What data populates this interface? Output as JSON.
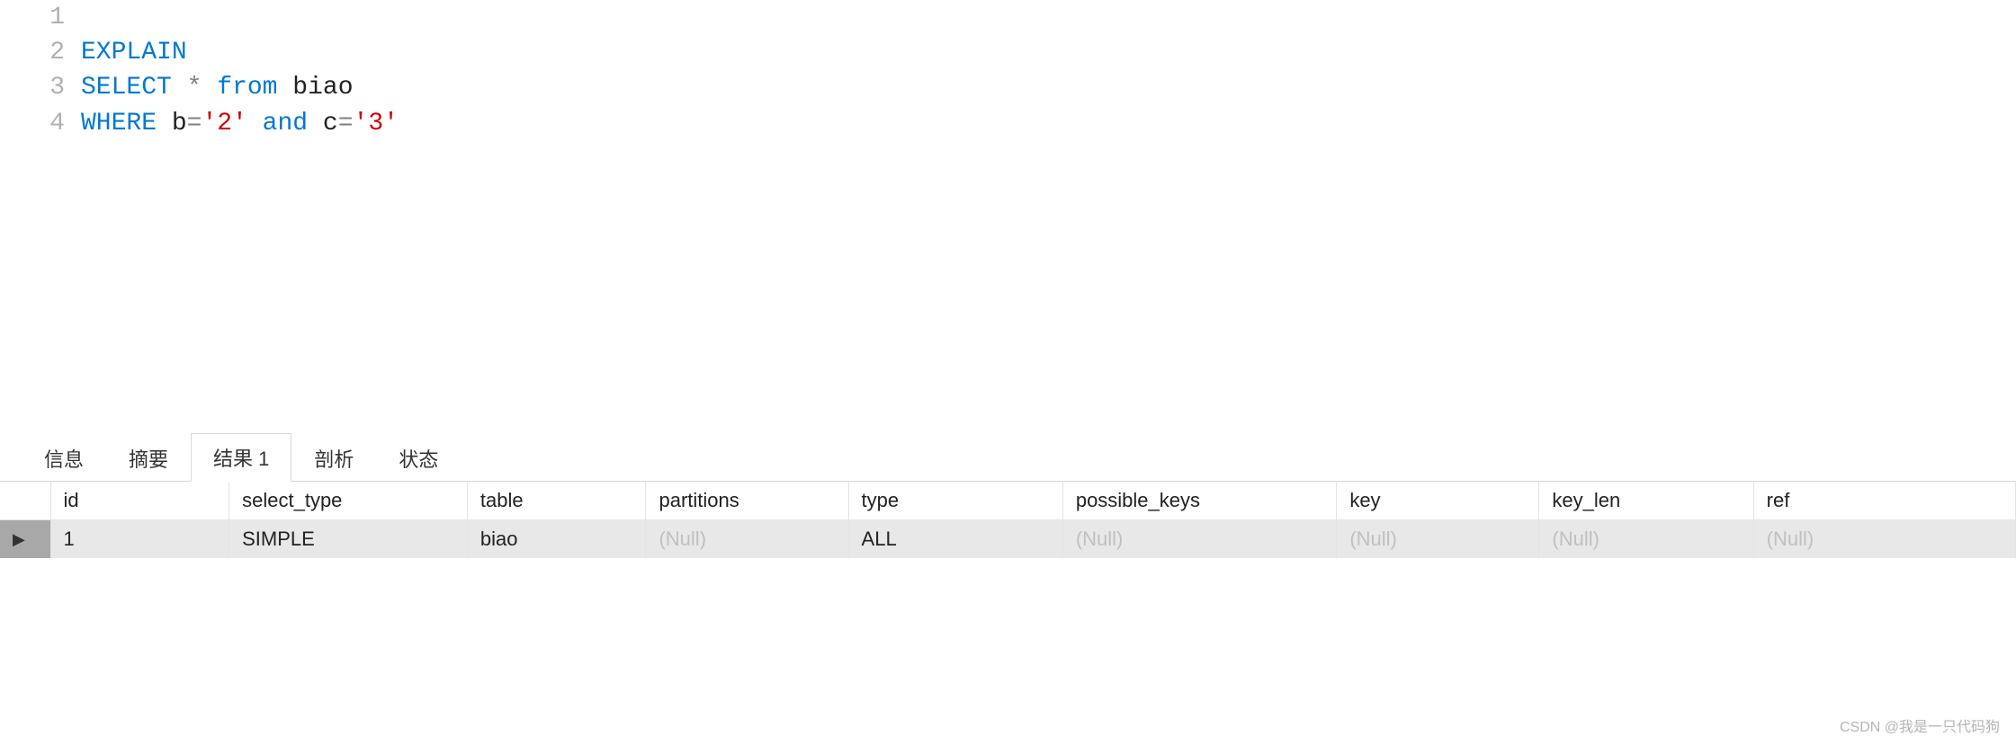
{
  "editor": {
    "lines": [
      {
        "num": "1",
        "tokens": []
      },
      {
        "num": "2",
        "tokens": [
          {
            "t": "EXPLAIN",
            "c": "kw"
          }
        ]
      },
      {
        "num": "3",
        "tokens": [
          {
            "t": "SELECT",
            "c": "kw"
          },
          {
            "t": " ",
            "c": "ident"
          },
          {
            "t": "*",
            "c": "star"
          },
          {
            "t": " ",
            "c": "ident"
          },
          {
            "t": "from",
            "c": "kw"
          },
          {
            "t": " biao",
            "c": "ident"
          }
        ]
      },
      {
        "num": "4",
        "tokens": [
          {
            "t": "WHERE",
            "c": "kw"
          },
          {
            "t": " b",
            "c": "ident"
          },
          {
            "t": "=",
            "c": "op"
          },
          {
            "t": "'2'",
            "c": "str"
          },
          {
            "t": " ",
            "c": "ident"
          },
          {
            "t": "and",
            "c": "kw"
          },
          {
            "t": " c",
            "c": "ident"
          },
          {
            "t": "=",
            "c": "op"
          },
          {
            "t": "'3'",
            "c": "str"
          }
        ]
      }
    ]
  },
  "tabs": {
    "items": [
      "信息",
      "摘要",
      "结果 1",
      "剖析",
      "状态"
    ],
    "active_index": 2
  },
  "result": {
    "columns": [
      "id",
      "select_type",
      "table",
      "partitions",
      "type",
      "possible_keys",
      "key",
      "key_len",
      "ref"
    ],
    "rows": [
      {
        "id": "1",
        "select_type": "SIMPLE",
        "table": "biao",
        "partitions": null,
        "type": "ALL",
        "possible_keys": null,
        "key": null,
        "key_len": null,
        "ref": null
      }
    ],
    "null_label": "(Null)",
    "row_marker": "▶"
  },
  "watermark": "CSDN @我是一只代码狗"
}
